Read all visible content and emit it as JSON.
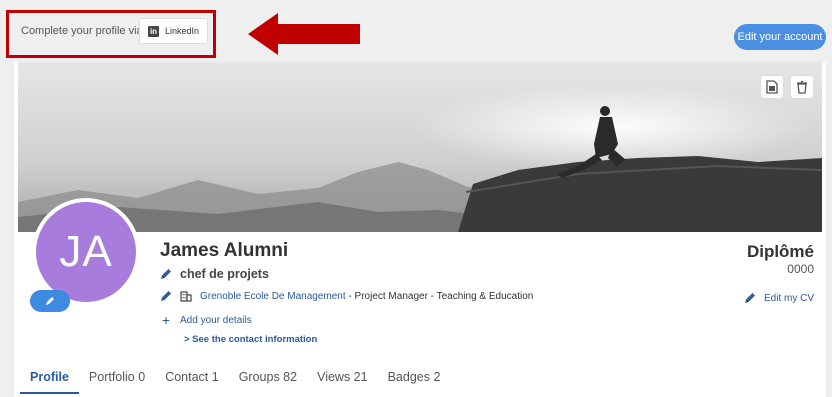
{
  "topbar": {
    "complete_text": "Complete your profile via",
    "linkedin_label": "LinkedIn",
    "edit_account_label": "Edit your account"
  },
  "profile": {
    "initials": "JA",
    "name": "James Alumni",
    "position": "chef de projets",
    "school": "Grenoble Ecole De Management",
    "school_details": " - Project Manager - Teaching & Education",
    "add_details": "Add your details",
    "contact_info": "> See the contact information",
    "diploma": "Diplômé",
    "year": "0000",
    "edit_cv": "Edit my CV"
  },
  "tabs": [
    "Profile",
    "Portfolio 0",
    "Contact 1",
    "Groups 82",
    "Views 21",
    "Badges 2"
  ],
  "colors": {
    "accent": "#4a90e2",
    "link": "#2d5a9a",
    "avatar": "#a77cdc",
    "highlight": "#c00000"
  }
}
